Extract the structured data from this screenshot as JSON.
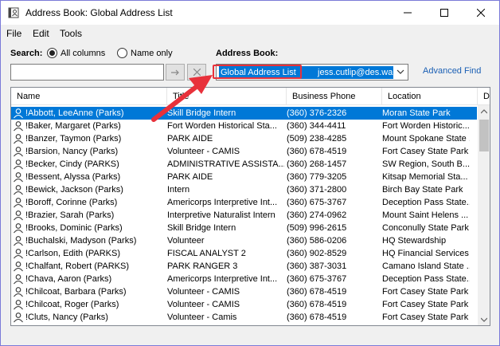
{
  "window": {
    "title": "Address Book: Global Address List"
  },
  "menu": [
    "File",
    "Edit",
    "Tools"
  ],
  "search": {
    "label": "Search:",
    "option_all": "All columns",
    "option_name": "Name only",
    "selected": "all",
    "value": "",
    "placeholder": ""
  },
  "address_book": {
    "label": "Address Book:",
    "selected_part1": "Global Address List",
    "selected_part2": "jess.cutlip@des.wa.g"
  },
  "advanced_find": "Advanced Find",
  "columns": [
    "Name",
    "Title",
    "Business Phone",
    "Location",
    "D"
  ],
  "rows": [
    {
      "name": "!Abbott, LeeAnne (Parks)",
      "title": "Skill Bridge Intern",
      "phone": "(360) 376-2326",
      "location": "Moran State Park",
      "selected": true
    },
    {
      "name": "!Baker, Margaret (Parks)",
      "title": "Fort Worden Historical Sta...",
      "phone": "(360) 344-4411",
      "location": "Fort Worden Historic..."
    },
    {
      "name": "!Banzer, Taymon (Parks)",
      "title": "PARK AIDE",
      "phone": "(509) 238-4285",
      "location": "Mount Spokane State ..."
    },
    {
      "name": "!Barsion, Nancy (Parks)",
      "title": "Volunteer - CAMIS",
      "phone": "(360) 678-4519",
      "location": "Fort Casey State Park"
    },
    {
      "name": "!Becker, Cindy (PARKS)",
      "title": "ADMINISTRATIVE ASSISTA...",
      "phone": "(360) 268-1457",
      "location": "SW Region, South B..."
    },
    {
      "name": "!Bessent, Alyssa (Parks)",
      "title": "PARK AIDE",
      "phone": "(360) 779-3205",
      "location": "Kitsap Memorial Sta..."
    },
    {
      "name": "!Bewick, Jackson (Parks)",
      "title": "Intern",
      "phone": "(360) 371-2800",
      "location": "Birch Bay State Park"
    },
    {
      "name": "!Boroff, Corinne (Parks)",
      "title": "Americorps Interpretive Int...",
      "phone": "(360) 675-3767",
      "location": "Deception Pass State..."
    },
    {
      "name": "!Brazier, Sarah (Parks)",
      "title": "Interpretive Naturalist Intern",
      "phone": "(360) 274-0962",
      "location": "Mount Saint Helens ..."
    },
    {
      "name": "!Brooks, Dominic (Parks)",
      "title": "Skill Bridge Intern",
      "phone": "(509) 996-2615",
      "location": "Conconully State Park"
    },
    {
      "name": "!Buchalski, Madyson (Parks)",
      "title": "Volunteer",
      "phone": "(360) 586-0206",
      "location": "HQ Stewardship"
    },
    {
      "name": "!Carlson, Edith (PARKS)",
      "title": "FISCAL ANALYST 2",
      "phone": "(360) 902-8529",
      "location": "HQ Financial Services"
    },
    {
      "name": "!Chalfant, Robert (PARKS)",
      "title": "PARK RANGER 3",
      "phone": "(360) 387-3031",
      "location": "Camano Island State ..."
    },
    {
      "name": "!Chava, Aaron (Parks)",
      "title": "Americorps Interpretive Int...",
      "phone": "(360) 675-3767",
      "location": "Deception Pass State..."
    },
    {
      "name": "!Chilcoat, Barbara (Parks)",
      "title": "Volunteer - CAMIS",
      "phone": "(360) 678-4519",
      "location": "Fort Casey State Park"
    },
    {
      "name": "!Chilcoat, Roger (Parks)",
      "title": "Volunteer - CAMIS",
      "phone": "(360) 678-4519",
      "location": "Fort Casey State Park"
    },
    {
      "name": "!Cluts, Nancy (Parks)",
      "title": "Volunteer - Camis",
      "phone": "(360) 678-4519",
      "location": "Fort Casey State Park"
    }
  ],
  "icons": {
    "app": "address-book-icon",
    "go": "arrow-right-icon",
    "clear": "close-icon",
    "dropdown": "chevron-down-icon",
    "contact": "person-icon"
  },
  "colors": {
    "selection": "#0078d7",
    "annotation": "#e8313b",
    "link": "#1a5fb4"
  }
}
